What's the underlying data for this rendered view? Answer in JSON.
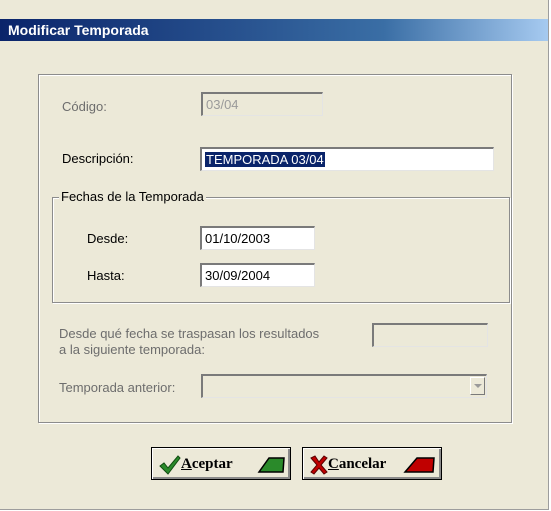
{
  "window": {
    "title": "Modificar Temporada"
  },
  "form": {
    "codigo": {
      "label": "Código:",
      "value": "03/04"
    },
    "descripcion": {
      "label": "Descripción:",
      "value": "TEMPORADA 03/04"
    },
    "fechas": {
      "legend": "Fechas de la Temporada",
      "desde": {
        "label": "Desde:",
        "value": "01/10/2003"
      },
      "hasta": {
        "label": "Hasta:",
        "value": "30/09/2004"
      }
    },
    "traspaso": {
      "label_line1": "Desde qué fecha se traspasan los resultados",
      "label_line2": "a la siguiente temporada:",
      "value": ""
    },
    "temporada_anterior": {
      "label": "Temporada anterior:",
      "value": ""
    }
  },
  "buttons": {
    "aceptar": {
      "mnemonic": "A",
      "rest": "ceptar",
      "icon": "checkmark-icon"
    },
    "cancelar": {
      "mnemonic": "C",
      "rest": "ancelar",
      "icon": "x-icon"
    }
  },
  "colors": {
    "title_start": "#0a246a",
    "title_end": "#a6caf0",
    "selection": "#0a246a",
    "check_green": "#2a8a2a",
    "cancel_red": "#c00000"
  }
}
